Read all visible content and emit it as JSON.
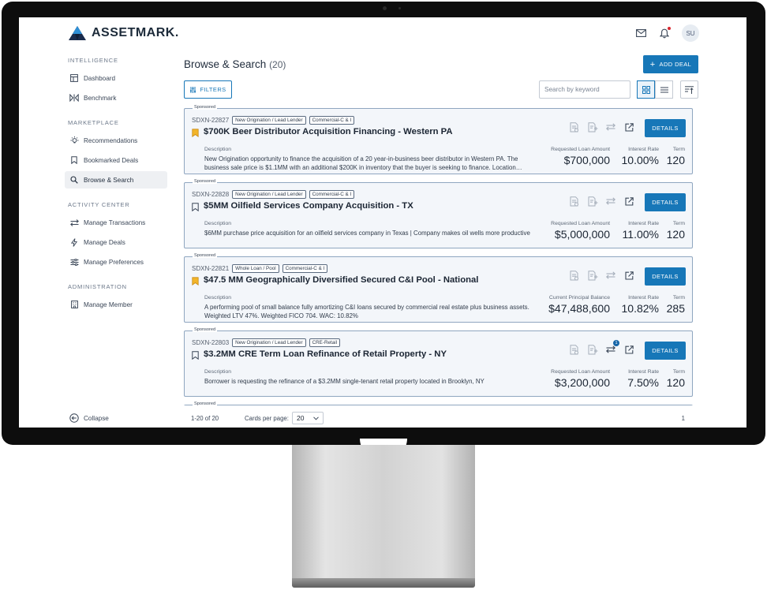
{
  "brand": {
    "name": "ASSETMARK.",
    "accent": "#1777b8"
  },
  "user": {
    "initials": "SU"
  },
  "top_icons": [
    "mail-icon",
    "bell-icon"
  ],
  "sidebar": {
    "sections": [
      {
        "title": "INTELLIGENCE",
        "items": [
          {
            "label": "Dashboard",
            "icon": "dashboard-icon"
          },
          {
            "label": "Benchmark",
            "icon": "benchmark-icon"
          }
        ]
      },
      {
        "title": "MARKETPLACE",
        "items": [
          {
            "label": "Recommendations",
            "icon": "lightbulb-icon"
          },
          {
            "label": "Bookmarked Deals",
            "icon": "bookmark-icon"
          },
          {
            "label": "Browse & Search",
            "icon": "search-icon",
            "active": true
          }
        ]
      },
      {
        "title": "ACTIVITY CENTER",
        "items": [
          {
            "label": "Manage Transactions",
            "icon": "transfer-icon"
          },
          {
            "label": "Manage Deals",
            "icon": "bolt-icon"
          },
          {
            "label": "Manage Preferences",
            "icon": "sliders-icon"
          }
        ]
      },
      {
        "title": "ADMINISTRATION",
        "items": [
          {
            "label": "Manage Member",
            "icon": "building-icon"
          }
        ]
      }
    ],
    "collapse_label": "Collapse"
  },
  "main": {
    "title": "Browse & Search",
    "count": "(20)",
    "add_deal_label": "ADD DEAL",
    "filters_label": "FILTERS",
    "search_placeholder": "Search by keyword"
  },
  "cards": [
    {
      "sponsored": "Sponsored",
      "id": "SDXN-22827",
      "tags": [
        "New Origination / Lead Lender",
        "Commercial-C & I"
      ],
      "bookmarked": true,
      "title": "$700K Beer Distributor Acquisition Financing - Western PA",
      "description_label": "Description",
      "description": "New Origination opportunity to finance the acquisition of a 20 year-in-business beer distributor in Western PA. The business sale price is $1.1MM with an additional $200K in inventory that the buyer is seeking to finance. Location…",
      "amount_label": "Requested Loan Amount",
      "amount": "$700,000",
      "rate_label": "Interest Rate",
      "rate": "10.00%",
      "term_label": "Term",
      "term": "120",
      "transfer_badge": null,
      "details_label": "DETAILS"
    },
    {
      "sponsored": "Sponsored",
      "id": "SDXN-22828",
      "tags": [
        "New Origination / Lead Lender",
        "Commercial-C & I"
      ],
      "bookmarked": false,
      "title": "$5MM Oilfield Services Company Acquisition - TX",
      "description_label": "Description",
      "description": "$6MM purchase price acquisition for an oilfield services company in Texas | Company makes oil wells more productive",
      "amount_label": "Requested Loan Amount",
      "amount": "$5,000,000",
      "rate_label": "Interest Rate",
      "rate": "11.00%",
      "term_label": "Term",
      "term": "120",
      "transfer_badge": null,
      "details_label": "DETAILS"
    },
    {
      "sponsored": "Sponsored",
      "id": "SDXN-22821",
      "tags": [
        "Whole Loan / Pool",
        "Commercial-C & I"
      ],
      "bookmarked": true,
      "title": "$47.5 MM Geographically Diversified Secured C&I Pool - National",
      "description_label": "Description",
      "description": "A performing pool of small balance fully amortizing C&I loans secured by commercial real estate plus business assets. Weighted LTV 47%. Weighted FICO 704. WAC: 10.82%",
      "amount_label": "Current Principal Balance",
      "amount": "$47,488,600",
      "rate_label": "Interest Rate",
      "rate": "10.82%",
      "term_label": "Term",
      "term": "285",
      "transfer_badge": null,
      "details_label": "DETAILS"
    },
    {
      "sponsored": "Sponsored",
      "id": "SDXN-22803",
      "tags": [
        "New Origination / Lead Lender",
        "CRE-Retail"
      ],
      "bookmarked": false,
      "title": "$3.2MM CRE Term Loan Refinance of Retail Property - NY",
      "description_label": "Description",
      "description": "Borrower is requesting the refinance of a $3.2MM single-tenant retail property located in Brooklyn, NY",
      "amount_label": "Requested Loan Amount",
      "amount": "$3,200,000",
      "rate_label": "Interest Rate",
      "rate": "7.50%",
      "term_label": "Term",
      "term": "120",
      "transfer_badge": "1",
      "details_label": "DETAILS"
    },
    {
      "sponsored": "Sponsored"
    }
  ],
  "pager": {
    "range": "1-20 of 20",
    "cards_per_page_label": "Cards per page:",
    "cards_per_page": "20",
    "page": "1"
  }
}
